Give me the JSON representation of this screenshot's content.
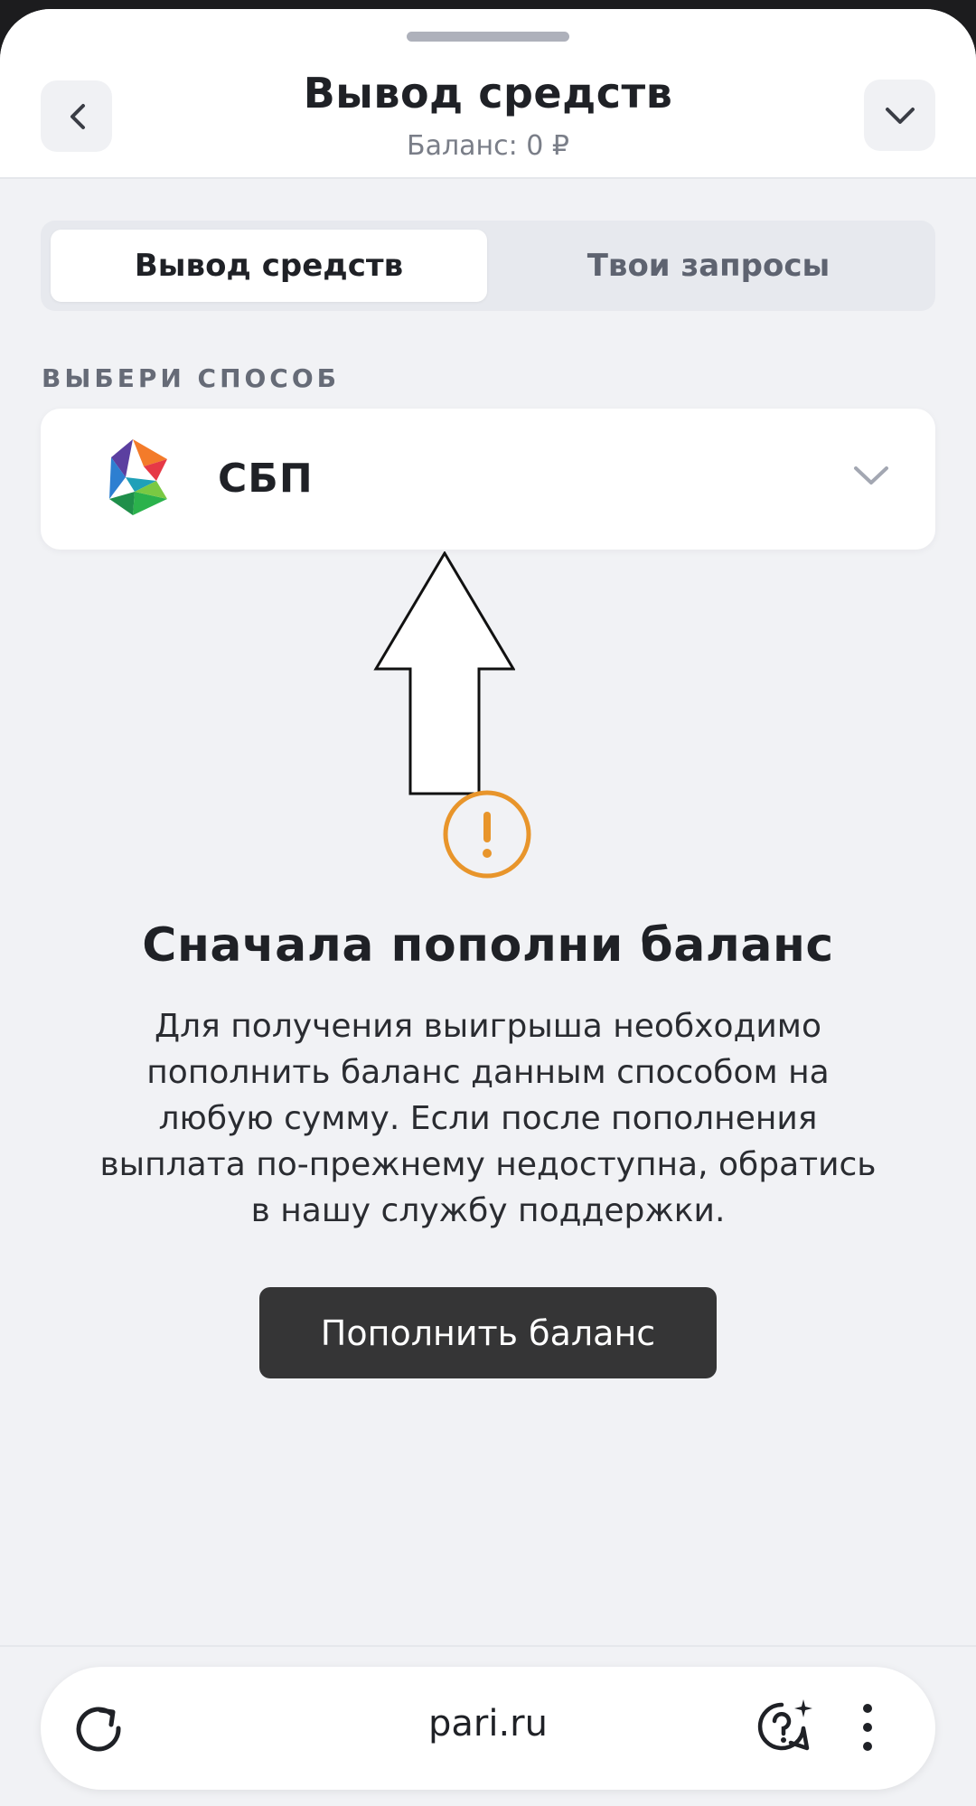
{
  "header": {
    "title": "Вывод средств",
    "balance": "Баланс: 0 ₽"
  },
  "tabs": [
    {
      "label": "Вывод средств",
      "active": true
    },
    {
      "label": "Твои запросы",
      "active": false
    }
  ],
  "method_section": {
    "label": "ВЫБЕРИ СПОСОБ",
    "selected": "СБП",
    "logo_icon": "sbp-logo"
  },
  "empty_state": {
    "icon": "warning-icon",
    "title": "Сначала пополни баланс",
    "text": "Для получения выигрыша необходимо пополнить баланс данным способом на любую сумму. Если после пополнения выплата по-прежнему недоступна, обратись в нашу службу поддержки.",
    "button_label": "Пополнить баланс"
  },
  "browser_bar": {
    "url": "pari.ru"
  },
  "colors": {
    "background": "#f1f2f5",
    "warning": "#e8952b",
    "button": "#353536",
    "text": "#1f2126"
  }
}
